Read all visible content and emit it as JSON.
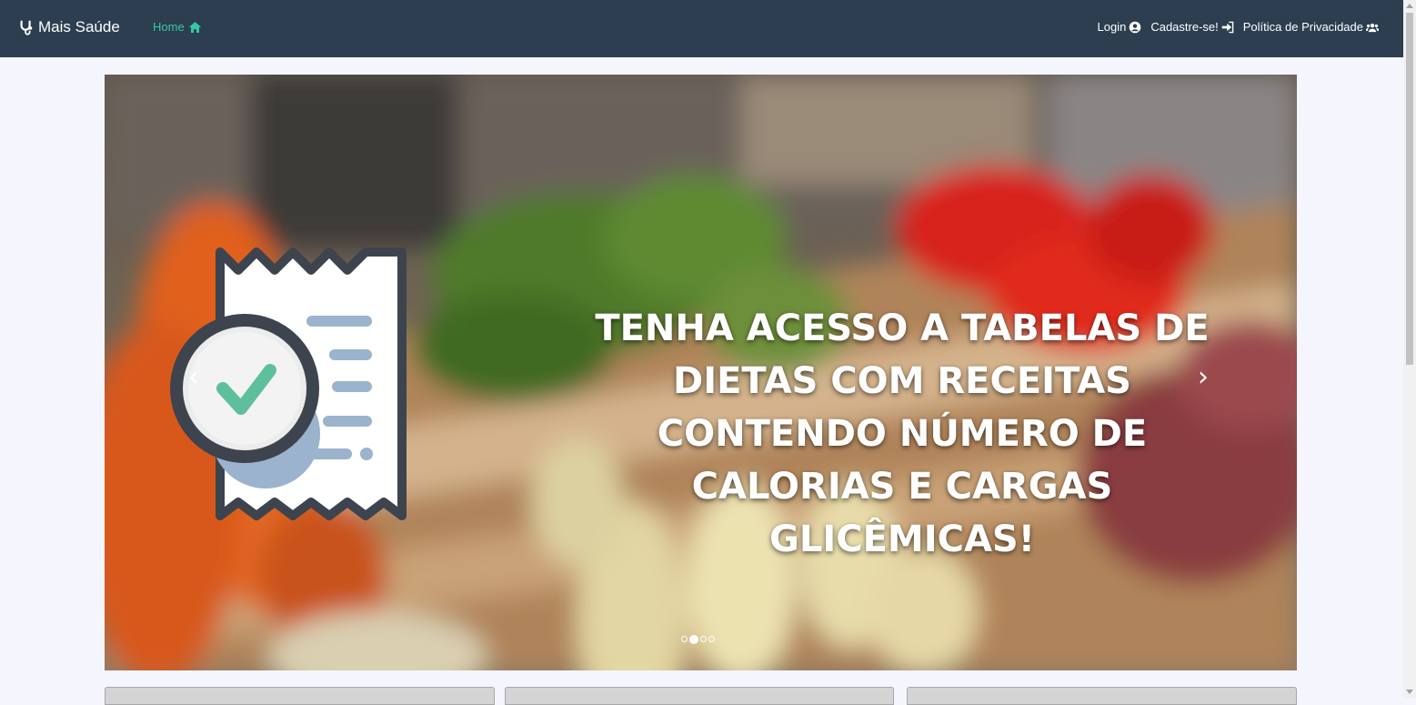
{
  "navbar": {
    "brand": "Mais Saúde",
    "brand_icon": "stethoscope-icon",
    "home_label": "Home",
    "home_icon": "home-icon",
    "links": [
      {
        "label": "Login",
        "icon": "user-circle-icon"
      },
      {
        "label": "Cadastre-se!",
        "icon": "sign-in-icon"
      },
      {
        "label": "Política de Privacidade",
        "icon": "users-icon"
      }
    ],
    "colors": {
      "background": "#2c3e50",
      "accent": "#35c8a5"
    }
  },
  "carousel": {
    "caption": "TENHA ACESSO A TABELAS DE DIETAS COM RECEITAS CONTENDO NÚMERO DE CALORIAS E CARGAS GLICÊMICAS!",
    "prev_label": "‹",
    "next_label": "›",
    "slide_count": 4,
    "active_slide": 2,
    "image_icon": "receipt-check-icon"
  }
}
